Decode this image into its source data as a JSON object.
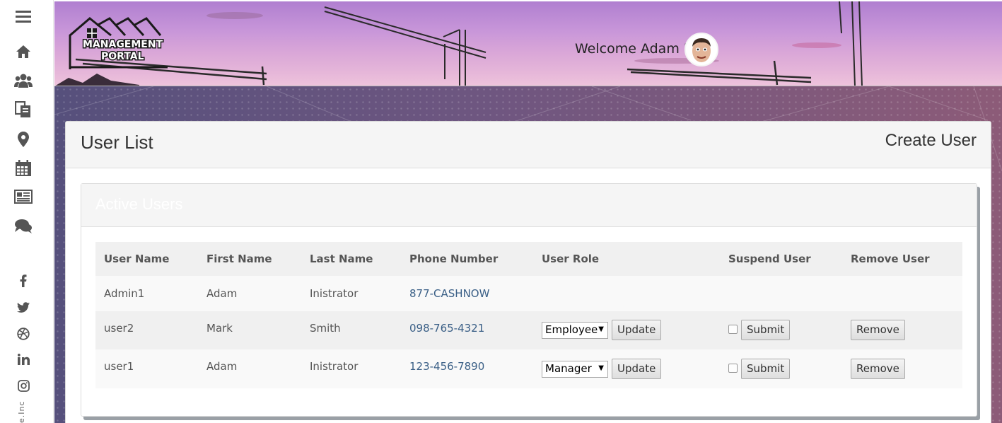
{
  "sidebar": {
    "icons": [
      "menu-icon",
      "home-icon",
      "users-icon",
      "documents-icon",
      "location-icon",
      "calendar-icon",
      "news-icon",
      "chat-icon"
    ],
    "social": [
      "facebook-icon",
      "twitter-icon",
      "dribbble-icon",
      "linkedin-icon",
      "instagram-icon"
    ],
    "copyright": "e.Inc"
  },
  "header": {
    "logo_line1": "MANAGEMENT",
    "logo_line2": "PORTAL",
    "welcome": "Welcome Adam I"
  },
  "page": {
    "title": "User List",
    "create_user": "Create User"
  },
  "panel": {
    "title": "Active Users"
  },
  "table": {
    "headers": [
      "User Name",
      "First Name",
      "Last Name",
      "Phone Number",
      "User Role",
      "Suspend User",
      "Remove User"
    ],
    "rows": [
      {
        "username": "Admin1",
        "first": "Adam",
        "last": "Inistrator",
        "phone": "877-CASHNOW"
      },
      {
        "username": "user2",
        "first": "Mark",
        "last": "Smith",
        "phone": "098-765-4321",
        "role": "Employee",
        "update": "Update",
        "suspended": false,
        "submit": "Submit",
        "remove": "Remove"
      },
      {
        "username": "user1",
        "first": "Adam",
        "last": "Inistrator",
        "phone": "123-456-7890",
        "role": "Manager",
        "update": "Update",
        "suspended": false,
        "submit": "Submit",
        "remove": "Remove"
      }
    ]
  },
  "colors": {
    "phone_link": "#3a5f86",
    "banner_sky": "#c896d9"
  }
}
